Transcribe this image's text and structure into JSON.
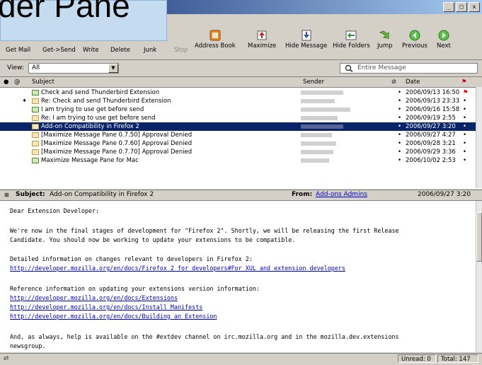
{
  "overlay": {
    "title": "der Pane"
  },
  "window": {
    "buttons": [
      "_",
      "□",
      "x"
    ]
  },
  "toolbar": {
    "get_mail": "Get Mail",
    "get_send": "Get->Send",
    "write": "Write",
    "delete": "Delete",
    "junk": "Junk",
    "stop": "Stop",
    "address_book": "Address Book",
    "maximize": "Maximize",
    "hide_message": "Hide Message",
    "hide_folders": "Hide Folders",
    "jump": "Jump",
    "previous": "Previous",
    "next": "Next"
  },
  "view": {
    "label": "View:",
    "value": "All"
  },
  "search": {
    "placeholder": "Entire Message"
  },
  "columns": {
    "subject": "Subject",
    "sender": "Sender",
    "date": "Date"
  },
  "messages": [
    {
      "subject": "Check and send Thunderbird Extension",
      "date": "2006/09/13 16:50"
    },
    {
      "subject": "Re: Check and send Thunderbird Extension",
      "date": "2006/09/13 23:33"
    },
    {
      "subject": "I am trying to use get before send",
      "date": "2006/09/16 15:58"
    },
    {
      "subject": "Re: I am trying to use get before send",
      "date": "2006/09/19 2:55"
    },
    {
      "subject": "Add-on Compatibility in Firefox 2",
      "date": "2006/09/27 3:20"
    },
    {
      "subject": "[Maximize Message Pane 0.7.50] Approval Denied",
      "date": "2006/09/27 4:27"
    },
    {
      "subject": "[Maximize Message Pane 0.7.60] Approval Denied",
      "date": "2006/09/28 3:21"
    },
    {
      "subject": "[Maximize Message Pane 0.7.70] Approval Denied",
      "date": "2006/09/29 3:36"
    },
    {
      "subject": "Maximize Message Pane for Mac",
      "date": "2006/10/02 2:53"
    }
  ],
  "header": {
    "subject_label": "Subject:",
    "subject": "Add-on Compatibility in Firefox 2",
    "from_label": "From:",
    "from": "Add-ons Admins",
    "date": "2006/09/27 3:20"
  },
  "body": {
    "greeting": "Dear Extension Developer:",
    "p1a": "We're now in the final stages of development for \"Firefox 2\".  Shortly, we will be releasing the first Release",
    "p1b": "Candidate. You should now be working to update your extensions to be compatible.",
    "p2": "Detailed information on changes relevant to developers in Firefox 2:",
    "link1": "http://developer.mozilla.org/en/docs/Firefox_2_for_developers#For_XUL_and_extension_developers",
    "p3": "Reference information on updating your extensions version information:",
    "link2": "http://developer.mozilla.org/en/docs/Extensions",
    "link3": "http://developer.mozilla.org/en/docs/Install_Manifests",
    "link4": "http://developer.mozilla.org/en/docs/Building_an_Extension",
    "p4a": "And, as always, help is available on the #extdev channel on irc.mozilla.org and in the mozilla.dev.extensions",
    "p4b": "newsgroup."
  },
  "status": {
    "unread": "Unread: 0",
    "total": "Total: 147"
  }
}
